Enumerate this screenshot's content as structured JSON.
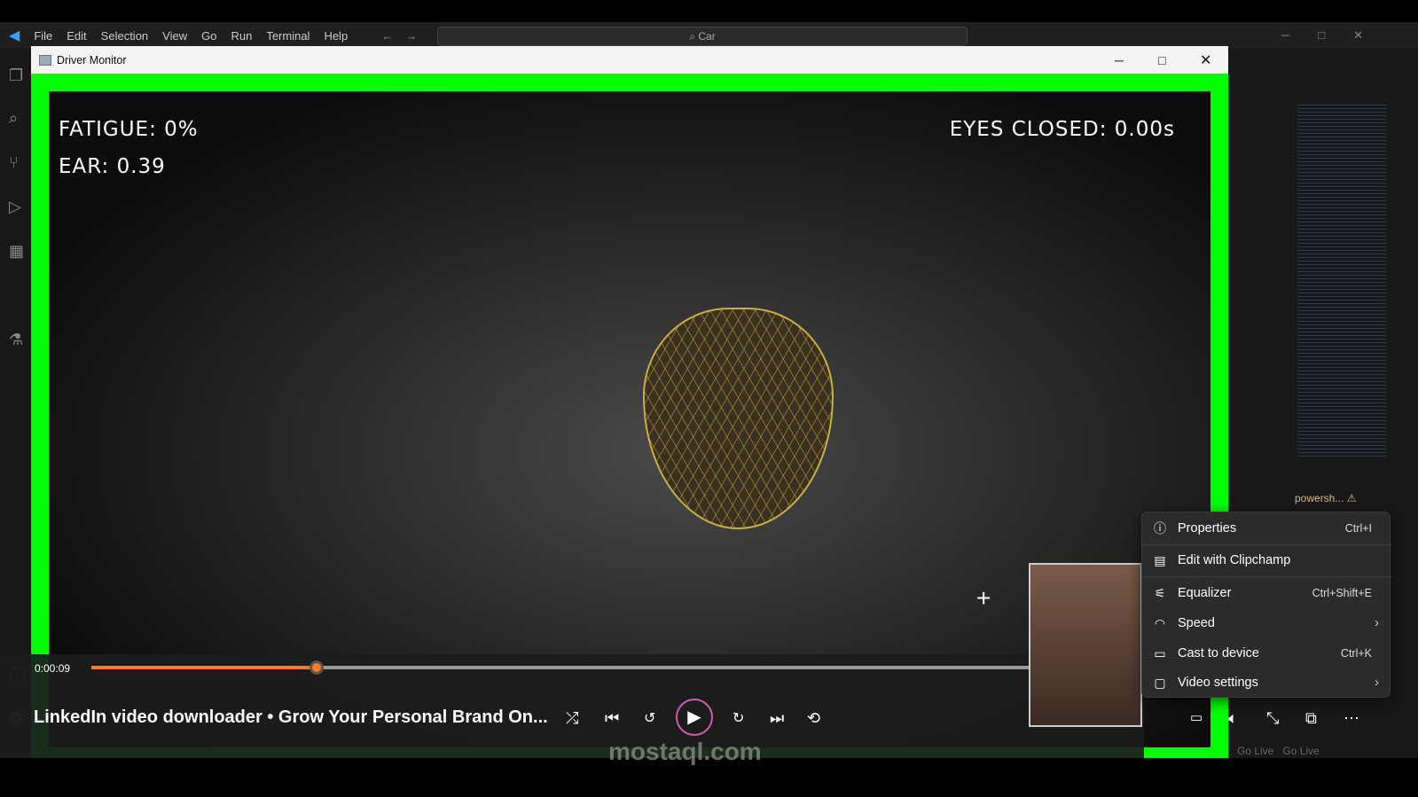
{
  "vscode": {
    "menu": [
      "File",
      "Edit",
      "Selection",
      "View",
      "Go",
      "Run",
      "Terminal",
      "Help"
    ],
    "search": "Car",
    "terminal_tab": "powersh...",
    "status": [
      "Go Live",
      "Go Live"
    ]
  },
  "window": {
    "title": "Driver Monitor"
  },
  "hud": {
    "fatigue": "FATIGUE: 0%",
    "ear": "EAR: 0.39",
    "eyes_closed": "EYES CLOSED: 0.00s"
  },
  "player": {
    "time": "0:00:09",
    "progress": 0.215,
    "title": "LinkedIn video downloader • Grow Your Personal Brand On...",
    "accent": "#ff7a22"
  },
  "context_menu": [
    {
      "label": "Properties",
      "shortcut": "Ctrl+I",
      "icon": "info-icon"
    },
    {
      "label": "Edit with Clipchamp",
      "shortcut": "",
      "icon": "clapper-icon"
    },
    {
      "label": "Equalizer",
      "shortcut": "Ctrl+Shift+E",
      "icon": "sliders-icon"
    },
    {
      "label": "Speed",
      "shortcut": "",
      "icon": "speed-icon",
      "submenu": true
    },
    {
      "label": "Cast to device",
      "shortcut": "Ctrl+K",
      "icon": "cast-icon"
    },
    {
      "label": "Video settings",
      "shortcut": "",
      "icon": "video-icon",
      "submenu": true
    }
  ],
  "watermark": {
    "text": "mostaql.com"
  }
}
